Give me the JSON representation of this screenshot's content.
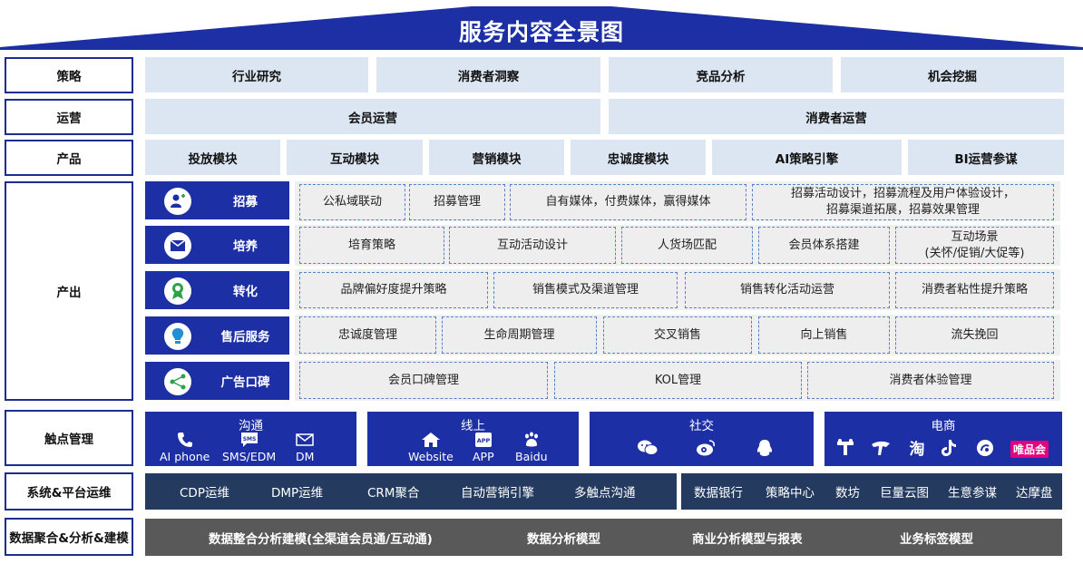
{
  "title": "服务内容全景图",
  "rows": {
    "strategy": {
      "label": "策略",
      "items": [
        "行业研究",
        "消费者洞察",
        "竞品分析",
        "机会挖掘"
      ]
    },
    "operation": {
      "label": "运营",
      "items": [
        "会员运营",
        "消费者运营"
      ]
    },
    "product": {
      "label": "产品",
      "items": [
        "投放模块",
        "互动模块",
        "营销模块",
        "忠诚度模块",
        "AI策略引擎",
        "BI运营参谋"
      ]
    },
    "output": {
      "label": "产出",
      "groups": [
        {
          "name": "招募",
          "icon": "user-add-icon",
          "items": [
            "公私域联动",
            "招募管理",
            "自有媒体，付费媒体，赢得媒体",
            "招募活动设计，招募流程及用户体验设计，\n招募渠道拓展，招募效果管理"
          ]
        },
        {
          "name": "培养",
          "icon": "envelope-icon",
          "items": [
            "培育策略",
            "互动活动设计",
            "人货场匹配",
            "会员体系搭建",
            "互动场景\n(关怀/促销/大促等)"
          ]
        },
        {
          "name": "转化",
          "icon": "award-icon",
          "items": [
            "品牌偏好度提升策略",
            "销售模式及渠道管理",
            "销售转化活动运营",
            "消费者粘性提升策略"
          ]
        },
        {
          "name": "售后服务",
          "icon": "bulb-icon",
          "items": [
            "忠诚度管理",
            "生命周期管理",
            "交叉销售",
            "向上销售",
            "流失挽回"
          ]
        },
        {
          "name": "广告口碑",
          "icon": "share-icon",
          "items": [
            "会员口碑管理",
            "KOL管理",
            "消费者体验管理"
          ]
        }
      ]
    },
    "touchpoint": {
      "label": "触点管理",
      "groups": [
        {
          "title": "沟通",
          "items": [
            "AI phone",
            "SMS/EDM",
            "DM"
          ]
        },
        {
          "title": "线上",
          "items": [
            "Website",
            "APP",
            "Baidu"
          ]
        },
        {
          "title": "社交",
          "items": []
        },
        {
          "title": "电商",
          "items": [
            "唯品会"
          ]
        }
      ]
    },
    "system": {
      "label": "系统&平台运维",
      "left": [
        "CDP运维",
        "DMP运维",
        "CRM聚合",
        "自动营销引擎",
        "多触点沟通"
      ],
      "right": [
        "数据银行",
        "策略中心",
        "数坊",
        "巨量云图",
        "生意参谋",
        "达摩盘"
      ]
    },
    "data": {
      "label": "数据聚合&分析&建模",
      "items": [
        "数据整合分析建模(全渠道会员通/互动通)",
        "数据分析模型",
        "商业分析模型与报表",
        "业务标签模型"
      ]
    }
  },
  "colors": {
    "navy": "#1c2fa5",
    "light_blue": "#dce6f2",
    "dark_slate": "#243a5e",
    "gray": "#595959",
    "dashed": "#5a7fc9"
  }
}
